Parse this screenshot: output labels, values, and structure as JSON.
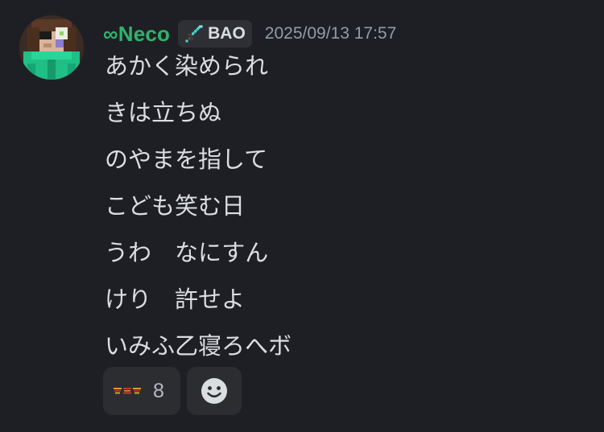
{
  "message": {
    "username": "∞Neco",
    "username_color": "#2fb36b",
    "clan_tag": {
      "icon": "diamond-sword-icon",
      "text": "BAO"
    },
    "timestamp": "2025/09/13 17:57",
    "avatar": "pixel-art-character-avatar",
    "lines": [
      "あかく染められ",
      "きは立ちぬ",
      "のやまを指して",
      "こども笑む日",
      "うわ　なにすん",
      "けり　許せよ",
      "いみふ乙寝ろへボ"
    ]
  },
  "reactions": [
    {
      "emoji": "custom-kanji-text-emoji",
      "count": "8"
    }
  ],
  "add_reaction": {
    "icon": "smile-icon"
  }
}
